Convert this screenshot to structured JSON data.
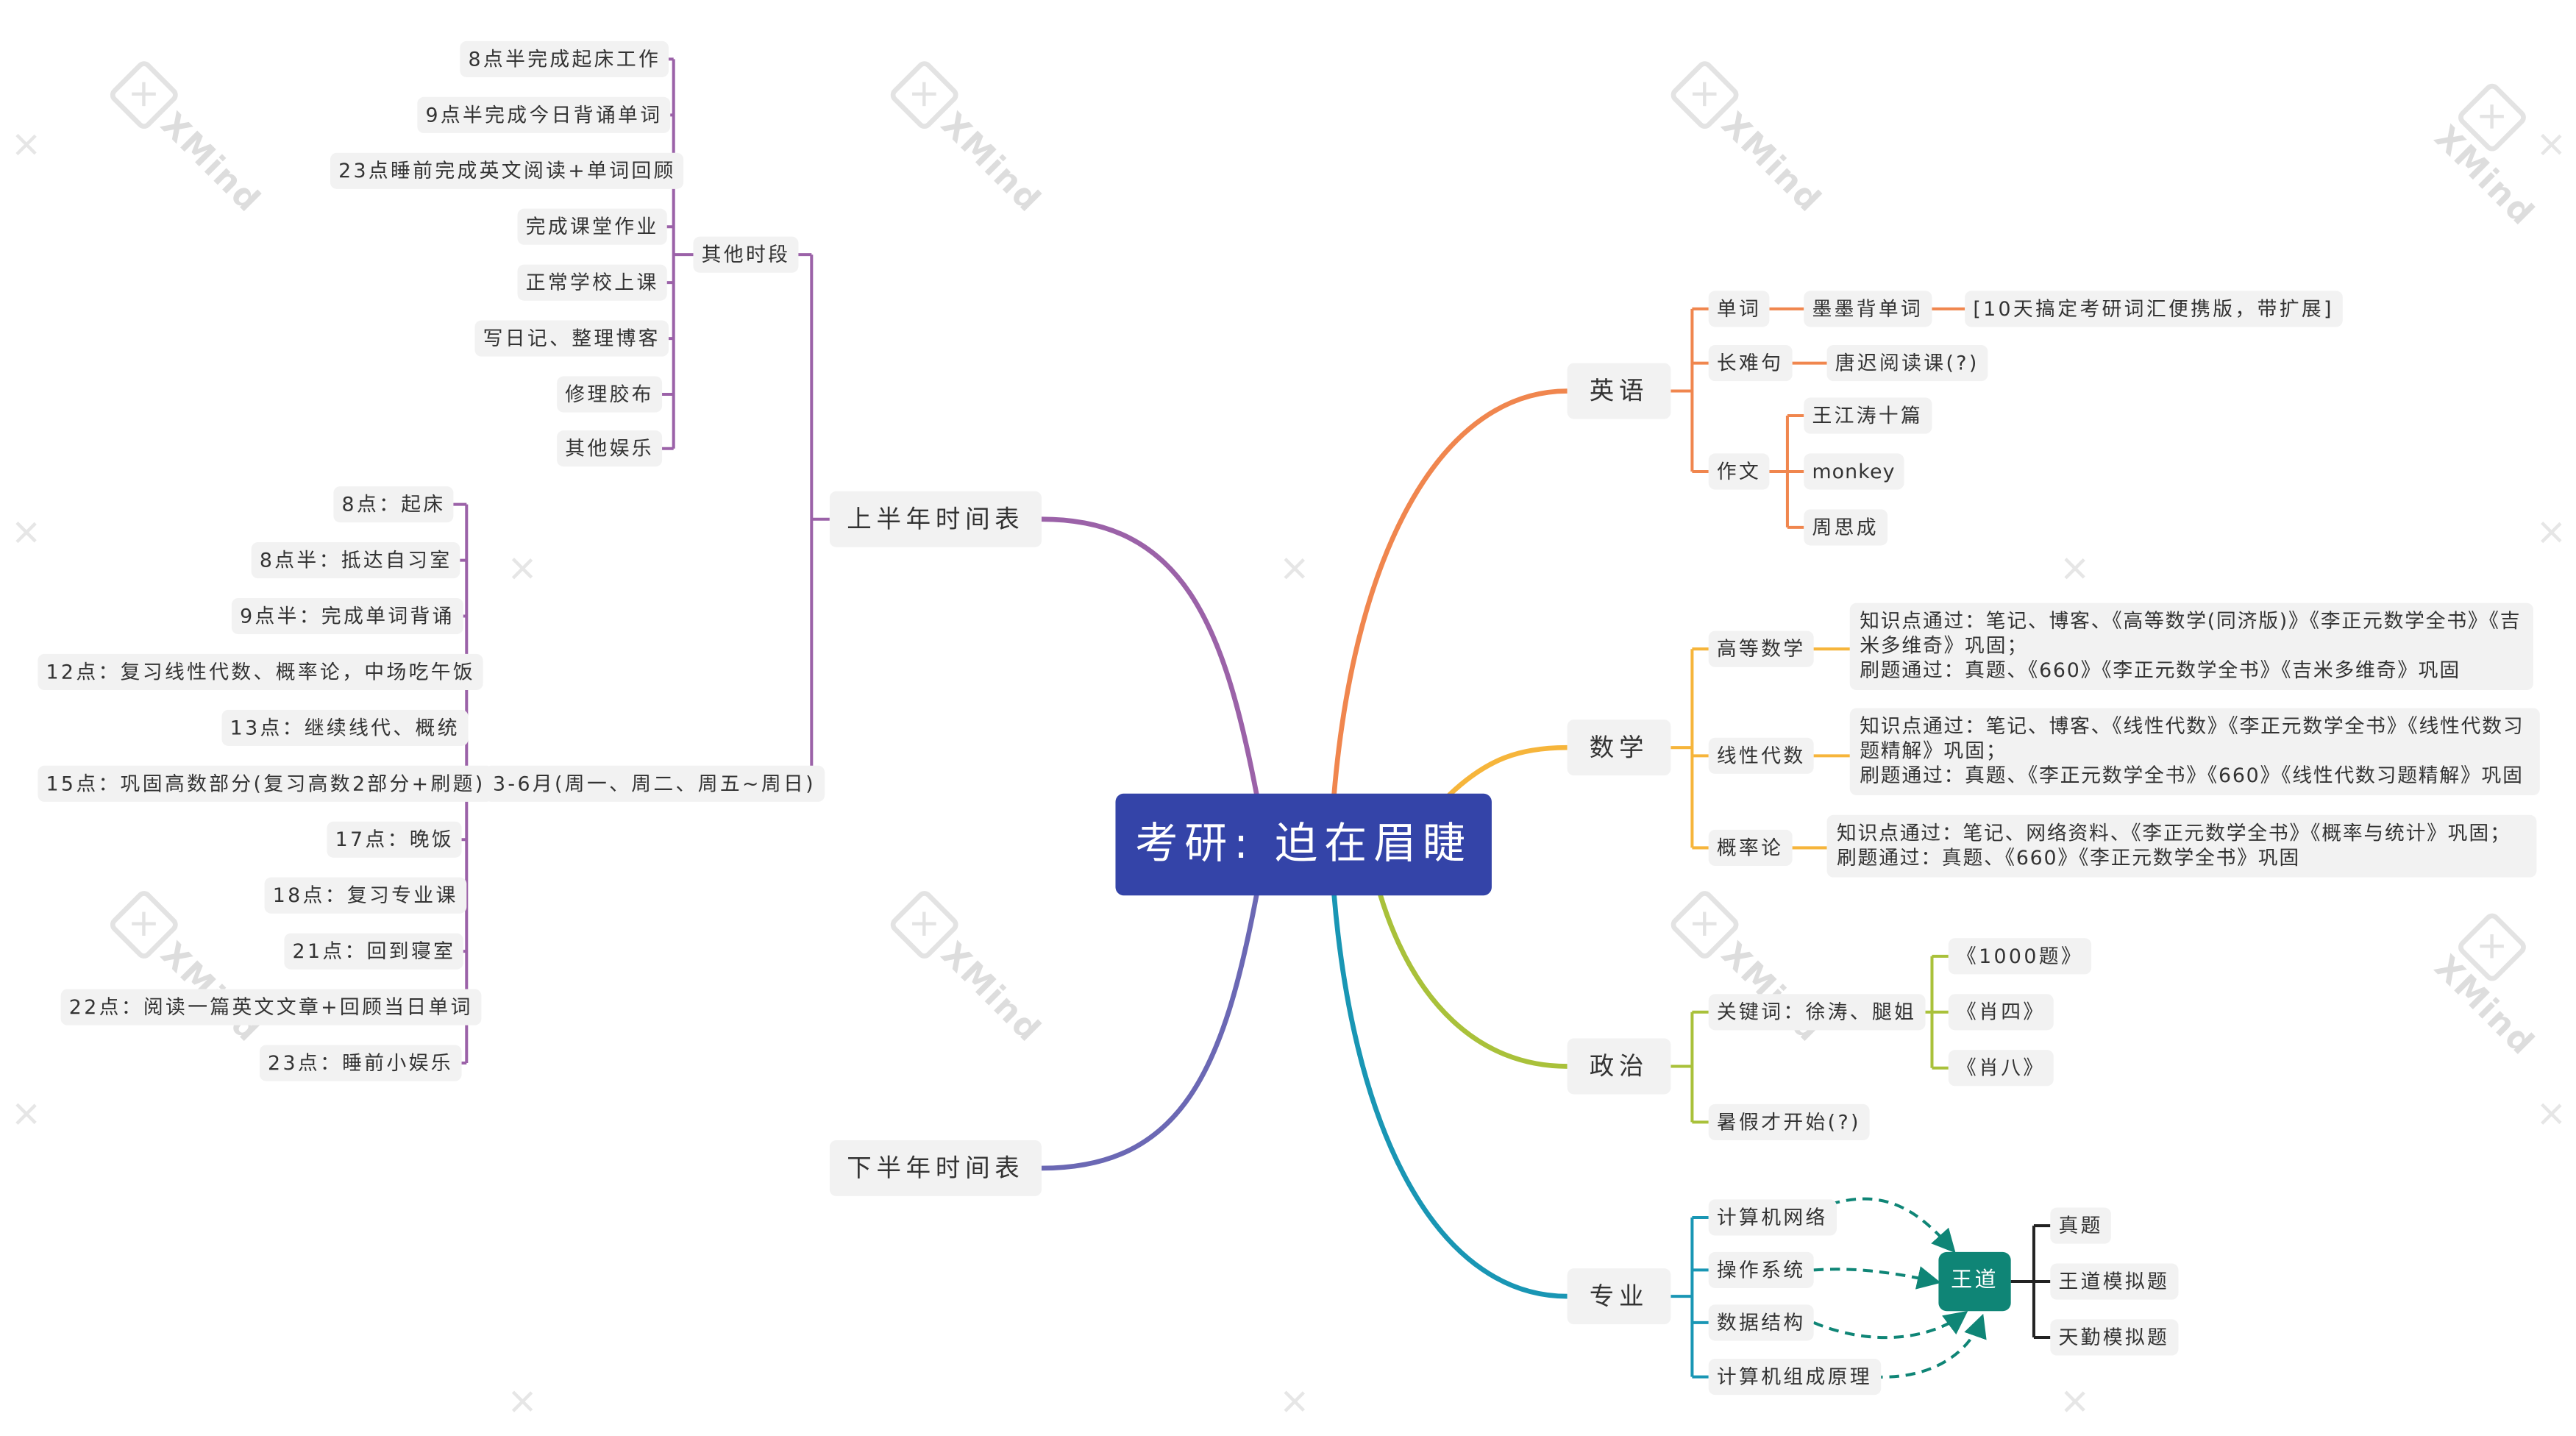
{
  "root": "考研: 迫在眉睫",
  "watermark": "XMind",
  "colors": {
    "root": "#3444a8",
    "english": "#f0864e",
    "math": "#f6b53b",
    "politics": "#a9c13a",
    "major": "#1996b4",
    "first_half": "#9b62a8",
    "second_half": "#6b68b4",
    "wangdao": "#0f8576"
  },
  "left": {
    "first_half": {
      "label": "上半年时间表",
      "other": {
        "label": "其他时段",
        "items": [
          "8点半完成起床工作",
          "9点半完成今日背诵单词",
          "23点睡前完成英文阅读+单词回顾",
          "完成课堂作业",
          "正常学校上课",
          "写日记、整理博客",
          "修理胶布",
          "其他娱乐"
        ]
      },
      "schedule": {
        "label": "3-6月(周一、周二、周五~周日)",
        "items": [
          "8点：起床",
          "8点半：抵达自习室",
          "9点半：完成单词背诵",
          "12点：复习线性代数、概率论，中场吃午饭",
          "13点：继续线代、概统",
          "15点：巩固高数部分(复习高数2部分+刷题)",
          "17点：晚饭",
          "18点：复习专业课",
          "21点：回到寝室",
          "22点：阅读一篇英文文章+回顾当日单词",
          "23点：睡前小娱乐"
        ]
      }
    },
    "second_half": {
      "label": "下半年时间表"
    }
  },
  "right": {
    "english": {
      "label": "英语",
      "vocab": {
        "label": "单词",
        "app": "墨墨背单词",
        "book": "[10天搞定考研词汇便携版，带扩展]"
      },
      "long": {
        "label": "长难句",
        "item": "唐迟阅读课(?)"
      },
      "essay": {
        "label": "作文",
        "items": [
          "王江涛十篇",
          "monkey",
          "周思成"
        ]
      }
    },
    "math": {
      "label": "数学",
      "calculus": {
        "label": "高等数学",
        "line1": "知识点通过：笔记、博客、《高等数学(同济版)》《李正元数学全书》《吉米多维奇》巩固；",
        "line2": "刷题通过：真题、《660》《李正元数学全书》《吉米多维奇》巩固"
      },
      "linear": {
        "label": "线性代数",
        "line1": "知识点通过：笔记、博客、《线性代数》《李正元数学全书》《线性代数习题精解》巩固；",
        "line2": "刷题通过：真题、《李正元数学全书》《660》《线性代数习题精解》巩固"
      },
      "prob": {
        "label": "概率论",
        "line1": "知识点通过：笔记、网络资料、《李正元数学全书》《概率与统计》巩固；",
        "line2": "刷题通过：真题、《660》《李正元数学全书》巩固"
      }
    },
    "politics": {
      "label": "政治",
      "keywords": {
        "label": "关键词：徐涛、腿姐",
        "items": [
          "《1000题》",
          "《肖四》",
          "《肖八》"
        ]
      },
      "summer": "暑假才开始(?)"
    },
    "major": {
      "label": "专业",
      "subjects": [
        "计算机网络",
        "操作系统",
        "数据结构",
        "计算机组成原理"
      ],
      "wangdao": {
        "label": "王道",
        "items": [
          "真题",
          "王道模拟题",
          "天勤模拟题"
        ]
      }
    }
  }
}
